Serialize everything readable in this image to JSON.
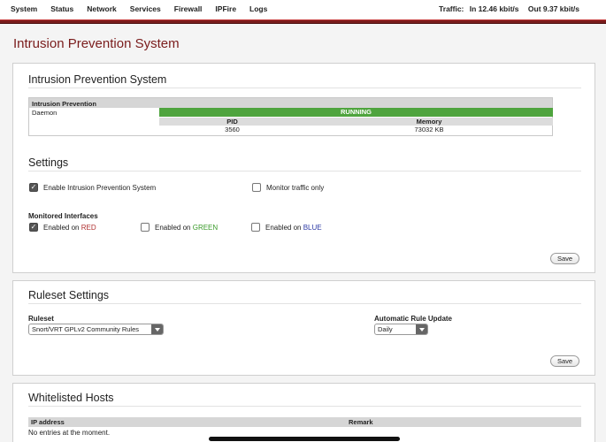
{
  "nav": {
    "items": [
      "System",
      "Status",
      "Network",
      "Services",
      "Firewall",
      "IPFire",
      "Logs"
    ],
    "traffic_label": "Traffic:",
    "traffic_in": "In 12.46 kbit/s",
    "traffic_out": "Out 9.37 kbit/s"
  },
  "page_title": "Intrusion Prevention System",
  "ips_panel": {
    "title": "Intrusion Prevention System",
    "table_header": "Intrusion Prevention",
    "daemon_label": "Daemon",
    "status": "RUNNING",
    "pid_header": "PID",
    "memory_header": "Memory",
    "pid": "3560",
    "memory": "73032 KB"
  },
  "settings": {
    "title": "Settings",
    "enable_ips": {
      "label": "Enable Intrusion Prevention System",
      "checked": true
    },
    "monitor_only": {
      "label": "Monitor traffic only",
      "checked": false
    },
    "interfaces_label": "Monitored Interfaces",
    "interfaces": {
      "red": {
        "prefix": "Enabled on",
        "zone": "RED",
        "checked": true
      },
      "green": {
        "prefix": "Enabled on",
        "zone": "GREEN",
        "checked": false
      },
      "blue": {
        "prefix": "Enabled on",
        "zone": "BLUE",
        "checked": false
      }
    },
    "save_label": "Save"
  },
  "ruleset": {
    "title": "Ruleset Settings",
    "ruleset_label": "Ruleset",
    "ruleset_value": "Snort/VRT GPLv2 Community Rules",
    "update_label": "Automatic Rule Update",
    "update_value": "Daily",
    "save_label": "Save"
  },
  "whitelist": {
    "title": "Whitelisted Hosts",
    "columns": [
      "IP address",
      "Remark"
    ],
    "empty_text": "No entries at the moment."
  },
  "colors": {
    "accent": "#7a1c1c",
    "running": "#4fa43e",
    "red_zone": "#b03030",
    "green_zone": "#3a9a2a",
    "blue_zone": "#2d3aa5"
  }
}
